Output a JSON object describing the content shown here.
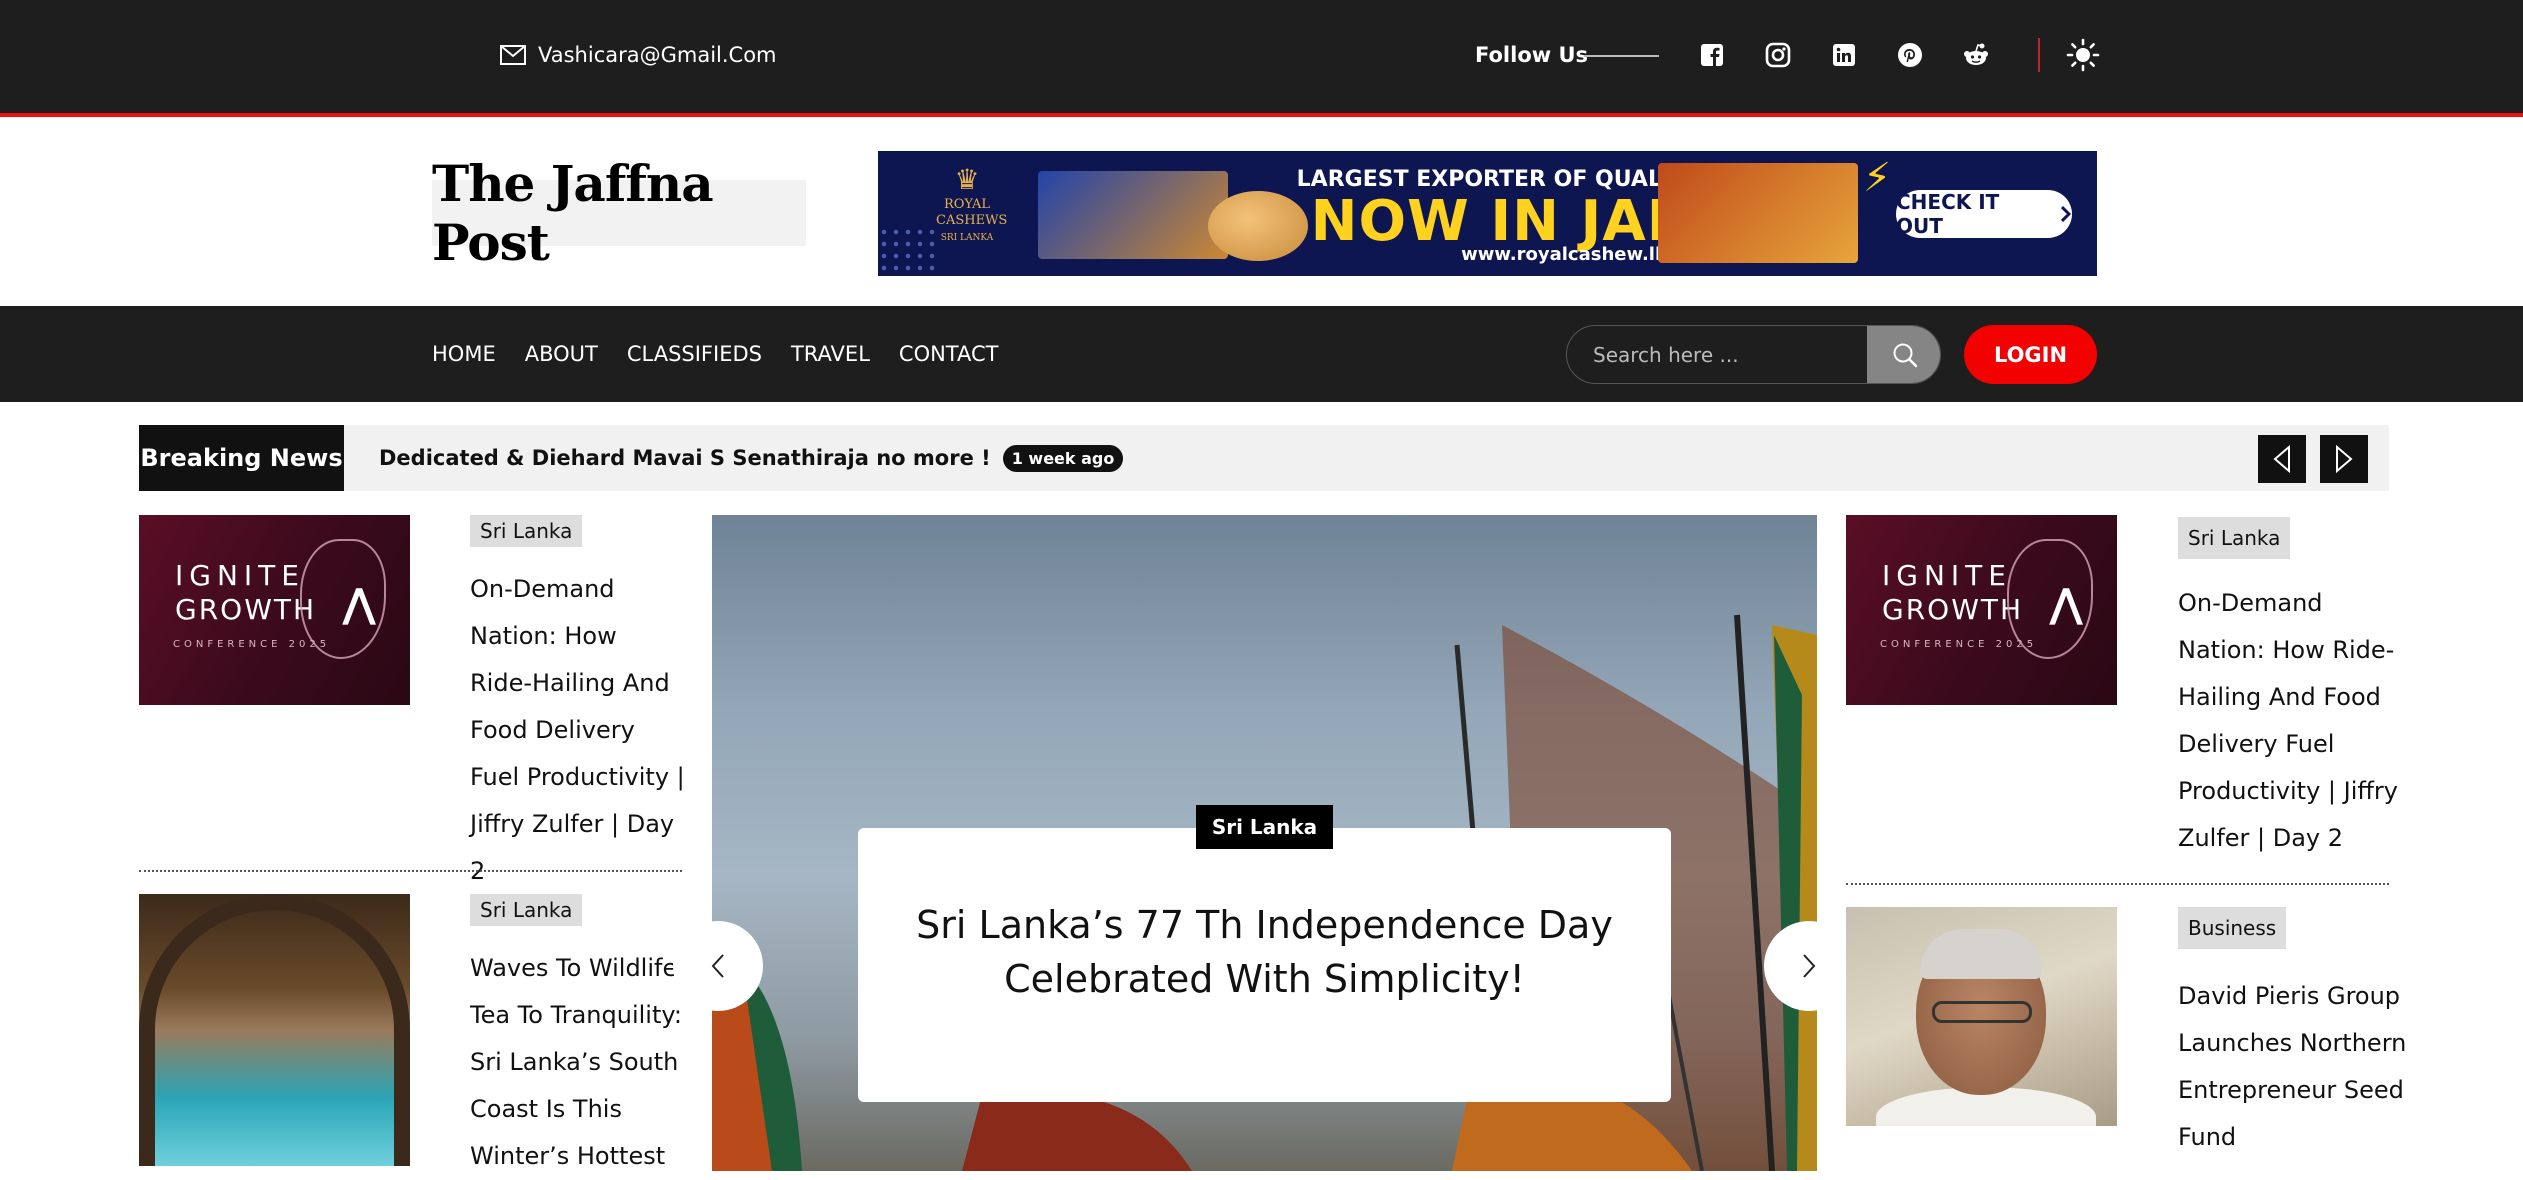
{
  "topbar": {
    "email": "Vashicara@Gmail.Com",
    "follow_label": "Follow Us",
    "social_icons": [
      "facebook-icon",
      "instagram-icon",
      "linkedin-icon",
      "pinterest-icon",
      "reddit-icon"
    ],
    "theme_icon": "sun-icon"
  },
  "header": {
    "logo_text": "The Jaffna Post",
    "banner": {
      "brand": "ROYAL CASHEWS",
      "brand_sub": "SRI LANKA",
      "line1": "LARGEST EXPORTER OF QUALITY CASHEWS",
      "line2": "NOW IN JAFFNA",
      "url": "www.royalcashew.lk",
      "cta": "CHECK IT OUT"
    }
  },
  "nav": {
    "items": [
      "HOME",
      "ABOUT",
      "CLASSIFIEDS",
      "TRAVEL",
      "CONTACT"
    ],
    "search_placeholder": "Search here ...",
    "login": "LOGIN"
  },
  "ticker": {
    "label": "Breaking News",
    "headline": "Dedicated & Diehard Mavai S Senathiraja no more !",
    "time": "1 week ago"
  },
  "left_posts": [
    {
      "category": "Sri Lanka",
      "title": "On-Demand Nation: How Ride-Hailing And Food Delivery Fuel Productivity | Jiffry Zulfer | Day 2",
      "image": {
        "line1": "IGNITE",
        "line2": "GROWTH",
        "line3": "CONFERENCE 2025"
      }
    },
    {
      "category": "Sri Lanka",
      "title": "Waves To Wildlife, Tea To Tranquility: Sri Lanka’s South Coast Is This Winter’s Hottest"
    }
  ],
  "hero": {
    "category": "Sri Lanka",
    "title": "Sri Lanka’s 77 Th Independence Day Celebrated With Simplicity!"
  },
  "right_posts": [
    {
      "category": "Sri Lanka",
      "title": "On-Demand Nation: How Ride-Hailing And Food Delivery Fuel Productivity | Jiffry Zulfer | Day 2",
      "image": {
        "line1": "IGNITE",
        "line2": "GROWTH",
        "line3": "CONFERENCE 2025"
      }
    },
    {
      "category": "Business",
      "title": "David Pieris Group Launches Northern Entrepreneur Seed Fund"
    }
  ]
}
